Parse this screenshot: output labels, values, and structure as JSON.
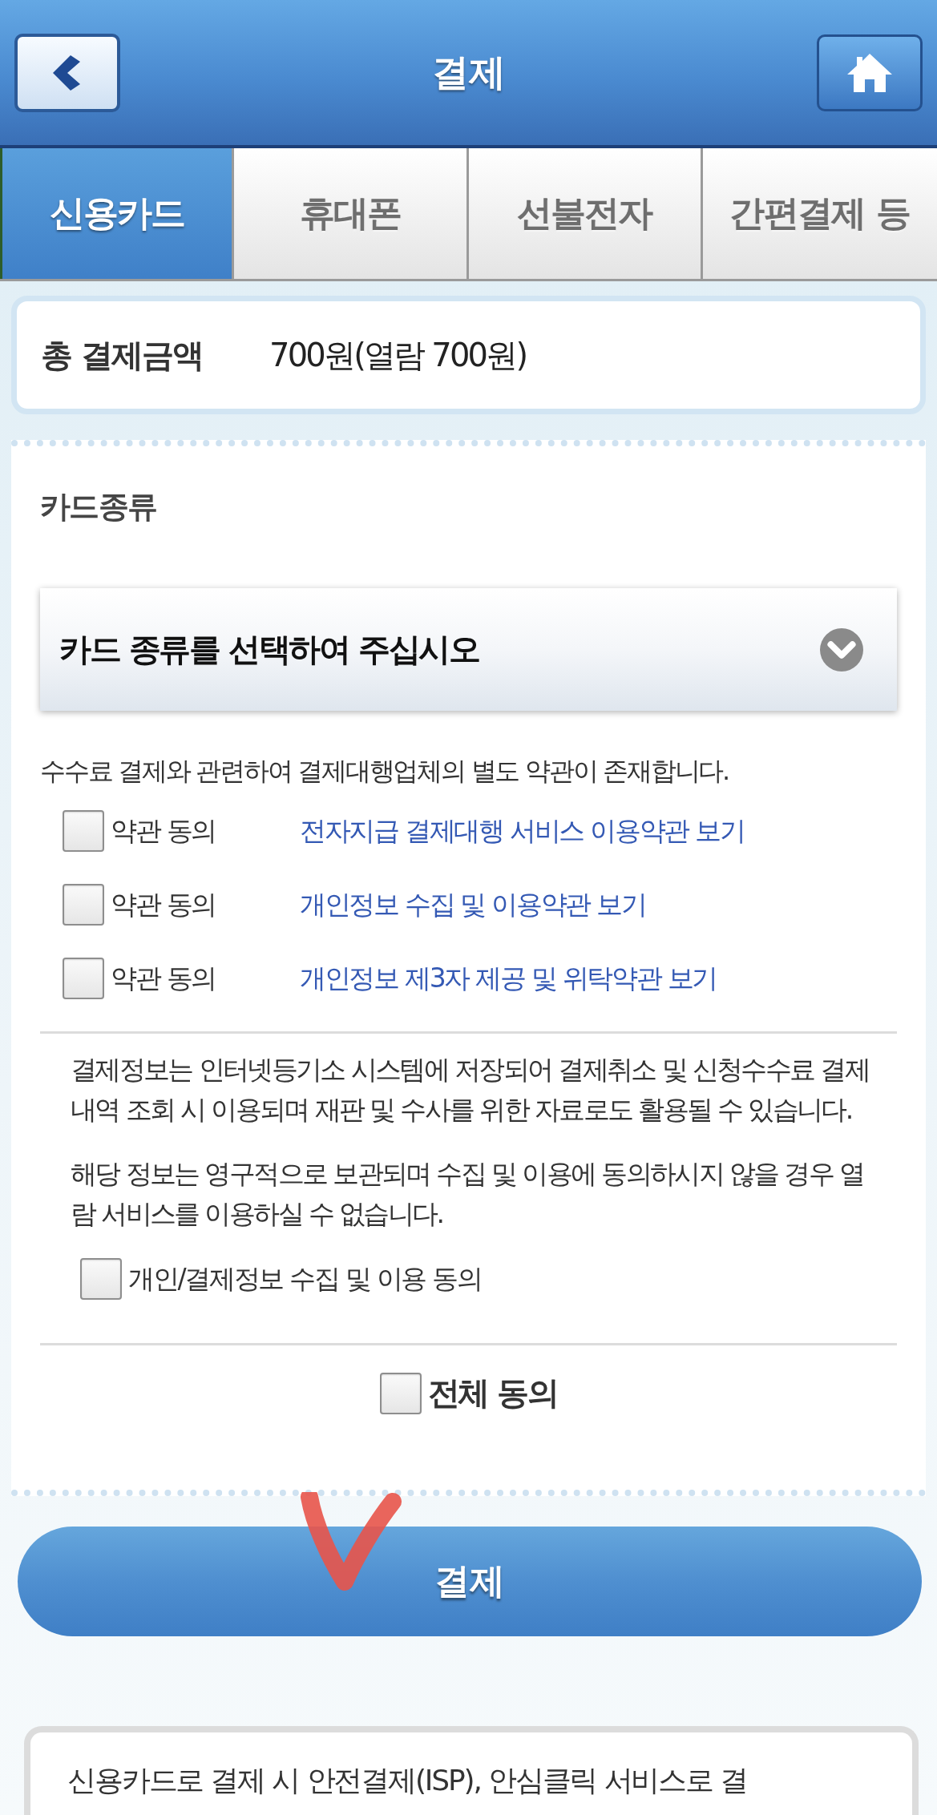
{
  "header": {
    "title": "결제"
  },
  "tabs": [
    {
      "label": "신용카드",
      "selected": true
    },
    {
      "label": "휴대폰",
      "selected": false
    },
    {
      "label": "선불전자",
      "selected": false
    },
    {
      "label": "간편결제 등",
      "selected": false
    }
  ],
  "total": {
    "label": "총 결제금액",
    "value": "700원(열람 700원)"
  },
  "card_type": {
    "label": "카드종류",
    "dropdown": {
      "value": "카드 종류를 선택하여 주십시오"
    }
  },
  "fee_notice": "수수료 결제와 관련하여 결제대행업체의 별도 약관이 존재합니다.",
  "terms": [
    {
      "label": "약관 동의",
      "link": "전자지급 결제대행 서비스 이용약관 보기",
      "checked": false
    },
    {
      "label": "약관 동의",
      "link": "개인정보 수집 및 이용약관 보기",
      "checked": false
    },
    {
      "label": "약관 동의",
      "link": "개인정보 제3자 제공 및 위탁약관 보기",
      "checked": false
    }
  ],
  "info_paragraphs": [
    "결제정보는 인터넷등기소 시스템에 저장되어 결제취소 및 신청수수료 결제 내역 조회 시 이용되며 재판 및 수사를 위한 자료로도 활용될 수 있습니다.",
    "해당 정보는 영구적으로 보관되며 수집 및 이용에 동의하시지 않을 경우 열람 서비스를 이용하실 수 없습니다."
  ],
  "consent": {
    "label": "개인/결제정보 수집 및 이용 동의",
    "checked": false
  },
  "agree_all": {
    "label": "전체 동의",
    "checked": false
  },
  "pay_button": {
    "label": "결제"
  },
  "notice_card": {
    "text": "신용카드로 결제 시 안전결제(ISP), 안심클릭 서비스로 결"
  }
}
